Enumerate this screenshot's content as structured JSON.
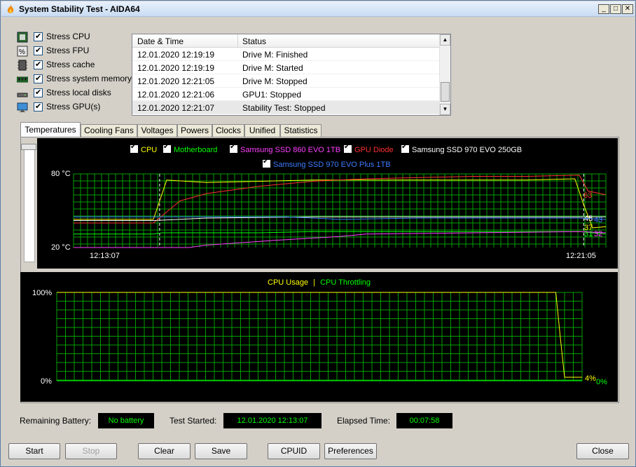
{
  "window": {
    "title": "System Stability Test - AIDA64"
  },
  "stress_options": [
    {
      "label": "Stress CPU",
      "icon": "cpu-chip-icon",
      "checked": true
    },
    {
      "label": "Stress FPU",
      "icon": "fpu-icon",
      "checked": true
    },
    {
      "label": "Stress cache",
      "icon": "cache-icon",
      "checked": true
    },
    {
      "label": "Stress system memory",
      "icon": "memory-module-icon",
      "checked": true
    },
    {
      "label": "Stress local disks",
      "icon": "hard-disk-icon",
      "checked": true
    },
    {
      "label": "Stress GPU(s)",
      "icon": "monitor-icon",
      "checked": true
    }
  ],
  "log": {
    "headers": {
      "datetime": "Date & Time",
      "status": "Status"
    },
    "rows": [
      {
        "datetime": "12.01.2020 12:19:19",
        "status": "Drive M: Finished"
      },
      {
        "datetime": "12.01.2020 12:19:19",
        "status": "Drive M: Started"
      },
      {
        "datetime": "12.01.2020 12:21:05",
        "status": "Drive M: Stopped"
      },
      {
        "datetime": "12.01.2020 12:21:06",
        "status": "GPU1: Stopped"
      },
      {
        "datetime": "12.01.2020 12:21:07",
        "status": "Stability Test: Stopped"
      }
    ]
  },
  "tabs": [
    "Temperatures",
    "Cooling Fans",
    "Voltages",
    "Powers",
    "Clocks",
    "Unified",
    "Statistics"
  ],
  "active_tab": "Temperatures",
  "colors": {
    "grid": "#00a000",
    "cpu": "#ffff00",
    "motherboard": "#00ff00",
    "ssd860": "#ff40ff",
    "gpu": "#ff3030",
    "ssd970_250": "#ffffff",
    "ssd970_plus": "#3e7bff"
  },
  "temp_legend": [
    {
      "label": "CPU",
      "color": "#ffff00"
    },
    {
      "label": "Motherboard",
      "color": "#00ff00"
    },
    {
      "label": "Samsung SSD 860 EVO 1TB",
      "color": "#ff40ff"
    },
    {
      "label": "GPU Diode",
      "color": "#ff3030"
    },
    {
      "label": "Samsung SSD 970 EVO 250GB",
      "color": "#ffffff"
    },
    {
      "label": "Samsung SSD 970 EVO Plus 1TB",
      "color": "#3e7bff"
    }
  ],
  "usage_legend": {
    "cpu_usage": "CPU Usage",
    "separator": "|",
    "cpu_throttling": "CPU Throttling"
  },
  "chart_data": [
    {
      "type": "line",
      "title": "",
      "y_axis": {
        "unit": "°C",
        "min": 20,
        "max": 80,
        "top_label": "80 °C",
        "bottom_label": "20 °C"
      },
      "x_axis": {
        "start_label": "12:13:07",
        "end_label": "12:21:05"
      },
      "markers": [
        "12:13:07",
        "12:21:05"
      ],
      "grid": true,
      "series": [
        {
          "name": "CPU",
          "color": "#ffff00",
          "current": "37",
          "times": [
            "12:11:30",
            "12:13:00",
            "12:13:15",
            "12:14:00",
            "12:15:00",
            "12:16:00",
            "12:17:00",
            "12:18:00",
            "12:19:00",
            "12:20:00",
            "12:20:55",
            "12:21:05",
            "12:21:15",
            "12:21:30"
          ],
          "values": [
            43,
            43,
            75,
            73,
            74,
            75,
            75,
            75,
            75,
            75,
            76,
            55,
            36,
            37
          ]
        },
        {
          "name": "Motherboard",
          "color": "#00ff00",
          "current": "31",
          "times": [
            "12:11:30",
            "12:13:00",
            "12:13:10",
            "12:15:00",
            "12:16:00",
            "12:17:30",
            "12:19:00",
            "12:21:00",
            "12:21:30"
          ],
          "values": [
            31,
            31,
            32,
            32,
            33,
            33,
            33,
            33,
            31
          ]
        },
        {
          "name": "Samsung SSD 860 EVO 1TB",
          "color": "#ff40ff",
          "current": "32",
          "times": [
            "12:11:30",
            "12:13:40",
            "12:14:00",
            "12:15:20",
            "12:16:30",
            "12:17:00",
            "12:19:00",
            "12:21:00",
            "12:21:30"
          ],
          "values": [
            20,
            20,
            22,
            26,
            29,
            31,
            32,
            33,
            32
          ]
        },
        {
          "name": "GPU Diode",
          "color": "#ff3030",
          "current": "63",
          "times": [
            "12:11:30",
            "12:13:00",
            "12:13:30",
            "12:14:00",
            "12:15:00",
            "12:16:00",
            "12:17:00",
            "12:18:00",
            "12:19:00",
            "12:20:00",
            "12:21:00",
            "12:21:10",
            "12:21:30"
          ],
          "values": [
            40,
            40,
            58,
            64,
            70,
            74,
            76,
            77,
            78,
            78,
            79,
            66,
            63
          ]
        },
        {
          "name": "Samsung SSD 970 EVO 250GB",
          "color": "#ffffff",
          "current": "45",
          "times": [
            "12:11:30",
            "12:13:00",
            "12:14:00",
            "12:16:00",
            "12:18:00",
            "12:21:00",
            "12:21:30"
          ],
          "values": [
            42,
            42,
            44,
            45,
            45,
            45,
            45
          ]
        },
        {
          "name": "Samsung SSD 970 EVO Plus 1TB",
          "color": "#3e7bff",
          "current": "43",
          "times": [
            "12:11:30",
            "12:13:00",
            "12:15:30",
            "12:16:30",
            "12:18:00",
            "12:21:00",
            "12:21:30"
          ],
          "values": [
            45,
            45,
            45,
            43,
            44,
            44,
            43
          ]
        }
      ]
    },
    {
      "type": "line",
      "title": "",
      "y_axis": {
        "unit": "%",
        "min": 0,
        "max": 100,
        "top_label": "100%",
        "bottom_label": "0%"
      },
      "grid": true,
      "series": [
        {
          "name": "CPU Usage",
          "color": "#ffff00",
          "current": "4%",
          "times": [
            "12:11:30",
            "12:21:00",
            "12:21:05",
            "12:21:10",
            "12:21:30"
          ],
          "values": [
            100,
            100,
            50,
            4,
            4
          ]
        },
        {
          "name": "CPU Throttling",
          "color": "#00ff00",
          "current": "0%",
          "times": [
            "12:11:30",
            "12:21:30"
          ],
          "values": [
            0,
            0
          ]
        }
      ]
    }
  ],
  "status": {
    "battery_label": "Remaining Battery:",
    "battery_value": "No battery",
    "started_label": "Test Started:",
    "started_value": "12.01.2020 12:13:07",
    "elapsed_label": "Elapsed Time:",
    "elapsed_value": "00:07:58"
  },
  "buttons": {
    "start": "Start",
    "stop": "Stop",
    "clear": "Clear",
    "save": "Save",
    "cpuid": "CPUID",
    "preferences": "Preferences",
    "close": "Close"
  }
}
